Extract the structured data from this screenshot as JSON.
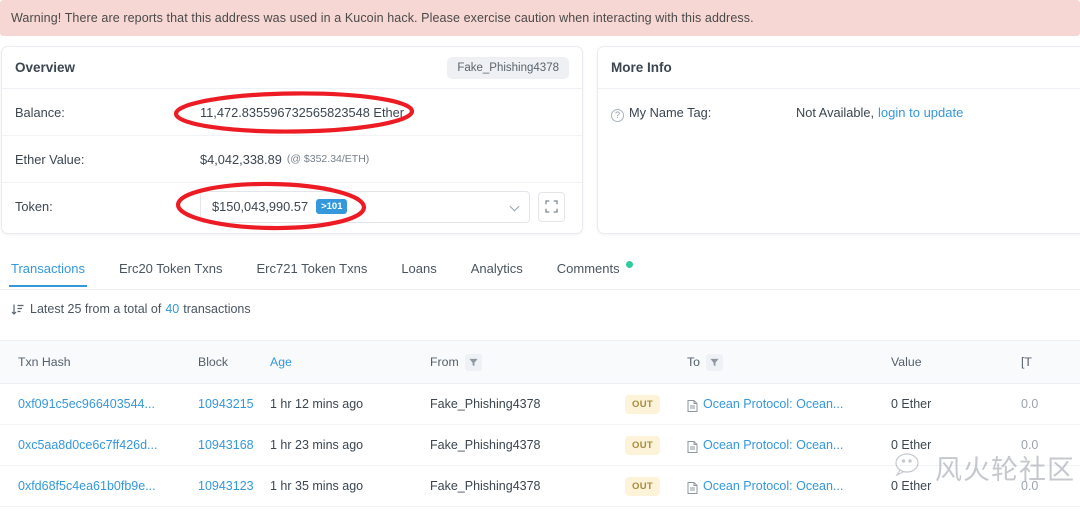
{
  "warning": {
    "text": "Warning! There are reports that this address was used in a Kucoin hack. Please exercise caution when interacting with this address."
  },
  "overview": {
    "title": "Overview",
    "tag": "Fake_Phishing4378",
    "balance_label": "Balance:",
    "balance_value": "11,472.835596732565823548 Ether",
    "ether_value_label": "Ether Value:",
    "ether_value": "$4,042,338.89",
    "ether_price": "(@ $352.34/ETH)",
    "token_label": "Token:",
    "token_value": "$150,043,990.57",
    "token_count": ">101",
    "dropdown_icon": "chevron-down-icon",
    "expand_icon": "expand-icon"
  },
  "more_info": {
    "title": "More Info",
    "name_tag_label": "My Name Tag:",
    "help_icon": "question-circle-icon",
    "name_tag_value": "Not Available,",
    "name_tag_link": "login to update"
  },
  "tabs": [
    {
      "label": "Transactions",
      "active": true,
      "dot": false
    },
    {
      "label": "Erc20 Token Txns",
      "active": false,
      "dot": false
    },
    {
      "label": "Erc721 Token Txns",
      "active": false,
      "dot": false
    },
    {
      "label": "Loans",
      "active": false,
      "dot": false
    },
    {
      "label": "Analytics",
      "active": false,
      "dot": false
    },
    {
      "label": "Comments",
      "active": false,
      "dot": true
    }
  ],
  "latest": {
    "sort_icon": "sort-descending-icon",
    "prefix": "Latest 25 from a total of",
    "count": "40",
    "suffix": "transactions"
  },
  "table": {
    "headers": {
      "txn_hash": "Txn Hash",
      "block": "Block",
      "age": "Age",
      "from": "From",
      "to": "To",
      "value": "Value",
      "fee": "[T",
      "from_filter_icon": "filter-icon",
      "to_filter_icon": "filter-icon"
    },
    "rows": [
      {
        "hash": "0xf091c5ec966403544...",
        "block": "10943215",
        "age": "1 hr 12 mins ago",
        "from": "Fake_Phishing4378",
        "direction": "OUT",
        "to_icon": "contract-icon",
        "to": "Ocean Protocol: Ocean...",
        "value": "0 Ether",
        "fee": "0.0"
      },
      {
        "hash": "0xc5aa8d0ce6c7ff426d...",
        "block": "10943168",
        "age": "1 hr 23 mins ago",
        "from": "Fake_Phishing4378",
        "direction": "OUT",
        "to_icon": "contract-icon",
        "to": "Ocean Protocol: Ocean...",
        "value": "0 Ether",
        "fee": "0.0"
      },
      {
        "hash": "0xfd68f5c4ea61b0fb9e...",
        "block": "10943123",
        "age": "1 hr 35 mins ago",
        "from": "Fake_Phishing4378",
        "direction": "OUT",
        "to_icon": "contract-icon",
        "to": "Ocean Protocol: Ocean...",
        "value": "0 Ether",
        "fee": "0.0"
      }
    ]
  },
  "watermark": {
    "icon": "wechat-icon",
    "text": "风火轮社区"
  },
  "annotations": {
    "balance_highlight": "red-oval",
    "token_highlight": "red-oval"
  },
  "colors": {
    "warning_bg": "#f7d7d3",
    "link": "#3498db",
    "accent": "#3498db",
    "badge_out_bg": "#fdf3d8",
    "badge_out_text": "#a98b3d",
    "green_dot": "#2ecc9e",
    "annotation_red": "#ed1c24"
  }
}
